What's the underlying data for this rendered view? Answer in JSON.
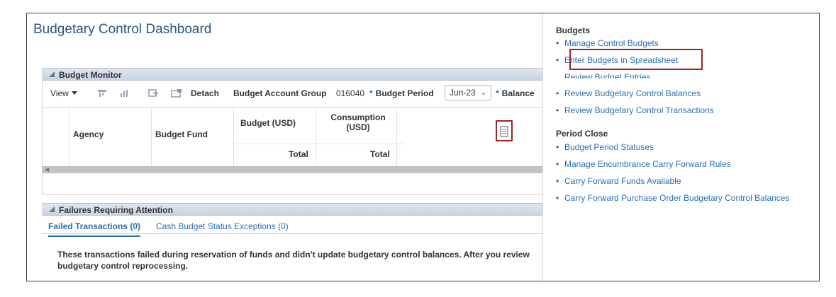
{
  "dashboard": {
    "title": "Budgetary Control Dashboard"
  },
  "budget_monitor": {
    "header": "Budget Monitor",
    "toolbar": {
      "view_label": "View",
      "detach_label": "Detach",
      "budget_account_group_label": "Budget Account Group",
      "budget_account_group_value": "016040",
      "budget_period_label": "Budget Period",
      "budget_period_value": "Jun-23",
      "balance_label": "Balance",
      "required_marker": "*"
    },
    "columns": {
      "agency": "Agency",
      "budget_fund": "Budget Fund",
      "budget_usd": "Budget (USD)",
      "consumption_usd_line1": "Consumption",
      "consumption_usd_line2": "(USD)",
      "total_budget": "Total",
      "total_consumption": "Total"
    },
    "icons": [
      "freeze-icon",
      "wrap-icon",
      "export-icon",
      "detach-icon",
      "column-picker-icon"
    ]
  },
  "failures": {
    "header": "Failures Requiring Attention",
    "tabs": [
      {
        "label": "Failed Transactions (0)",
        "active": true
      },
      {
        "label": "Cash Budget Status Exceptions (0)",
        "active": false
      }
    ],
    "message_line1": "These transactions failed during reservation of funds and didn't update budgetary control balances. After you review",
    "message_line2": "budgetary control reprocessing."
  },
  "tasks": {
    "budgets": {
      "heading": "Budgets",
      "items": [
        "Manage Control Budgets",
        "Enter Budgets in Spreadsheet",
        "Review Budget Entries",
        "Review Budgetary Control Balances",
        "Review Budgetary Control Transactions"
      ]
    },
    "period_close": {
      "heading": "Period Close",
      "items": [
        "Budget Period Statuses",
        "Manage Encumbrance Carry Forward Rules",
        "Carry Forward Funds Available",
        "Carry Forward Purchase Order Budgetary Control Balances"
      ]
    }
  },
  "colors": {
    "link": "#2a6fb6",
    "title": "#2a5684",
    "highlight": "#9b2424"
  }
}
